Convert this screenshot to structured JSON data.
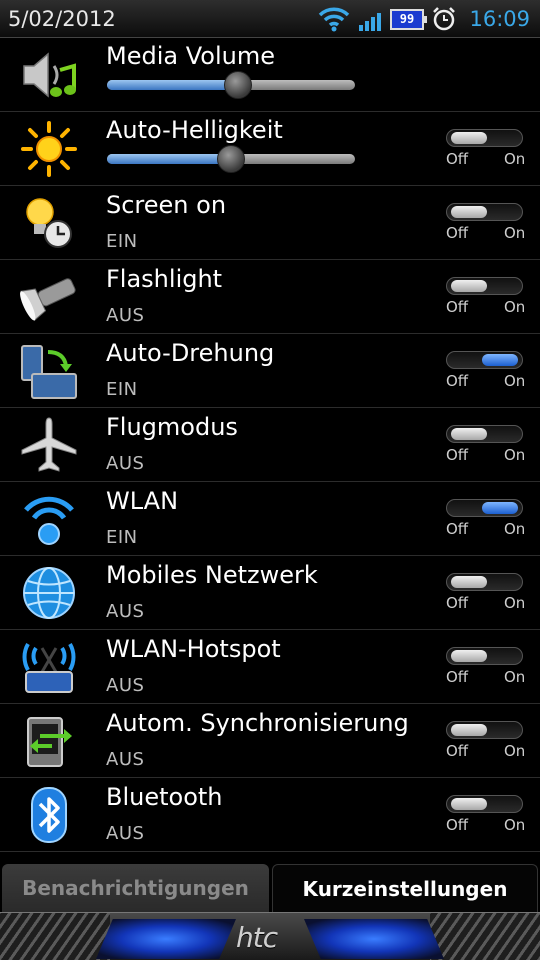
{
  "status_bar": {
    "date": "5/02/2012",
    "time": "16:09",
    "battery": "99",
    "icons": [
      "wifi-icon",
      "signal-icon",
      "battery-icon",
      "alarm-icon"
    ]
  },
  "rows": [
    {
      "title": "Media Volume",
      "subtitle": "",
      "icon": "media-volume-icon",
      "control": "slider",
      "slider_value": 0.53
    },
    {
      "title": "Auto-Helligkeit",
      "subtitle": "",
      "icon": "sun-icon",
      "control": "slider+toggle",
      "slider_value": 0.5,
      "toggle": "off"
    },
    {
      "title": "Screen on",
      "subtitle": "EIN",
      "icon": "bulb-clock-icon",
      "toggle": "off"
    },
    {
      "title": "Flashlight",
      "subtitle": "AUS",
      "icon": "flashlight-icon",
      "toggle": "off"
    },
    {
      "title": "Auto-Drehung",
      "subtitle": "EIN",
      "icon": "rotate-icon",
      "toggle": "on"
    },
    {
      "title": "Flugmodus",
      "subtitle": "AUS",
      "icon": "airplane-icon",
      "toggle": "off"
    },
    {
      "title": "WLAN",
      "subtitle": "EIN",
      "icon": "wlan-icon",
      "toggle": "on"
    },
    {
      "title": "Mobiles Netzwerk",
      "subtitle": "AUS",
      "icon": "globe-icon",
      "toggle": "off"
    },
    {
      "title": "WLAN-Hotspot",
      "subtitle": "AUS",
      "icon": "hotspot-icon",
      "toggle": "off"
    },
    {
      "title": "Autom. Synchronisierung",
      "subtitle": "AUS",
      "icon": "sync-icon",
      "toggle": "off"
    },
    {
      "title": "Bluetooth",
      "subtitle": "AUS",
      "icon": "bluetooth-icon",
      "toggle": "off"
    }
  ],
  "toggle_labels": {
    "off": "Off",
    "on": "On"
  },
  "tabs": [
    {
      "label": "Benachrichtigungen",
      "active": false
    },
    {
      "label": "Kurzeinstellungen",
      "active": true
    }
  ],
  "footer": {
    "logo": "htc"
  },
  "colors": {
    "accent": "#3aa8e8",
    "toggle_on": "#1c5fd0",
    "background": "#000000"
  }
}
